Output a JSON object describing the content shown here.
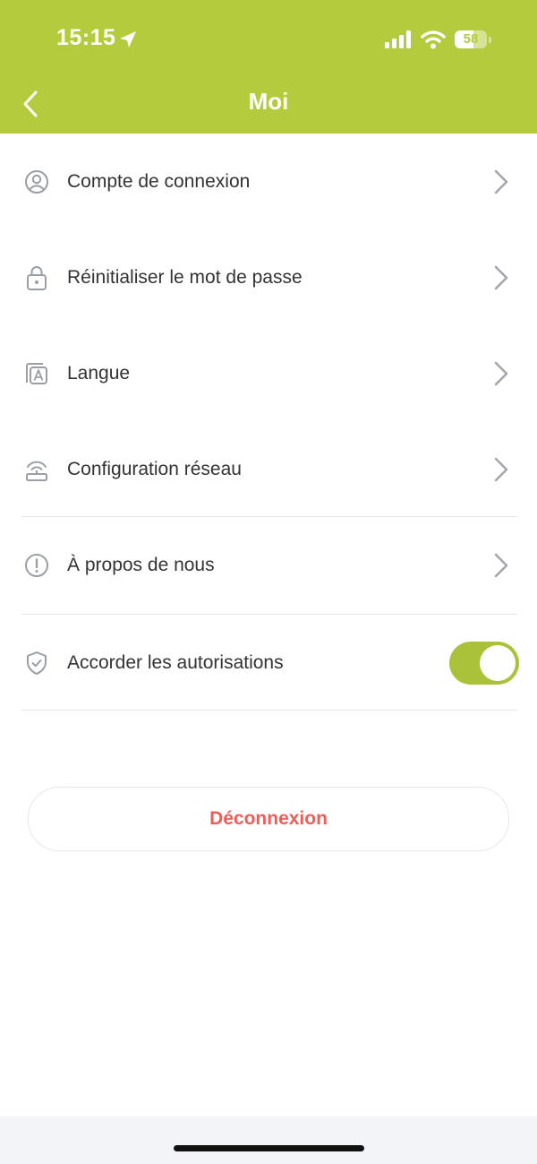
{
  "status_bar": {
    "time": "15:15",
    "battery_level": "58",
    "battery_percent": 58,
    "location_icon": "location-arrow-icon",
    "signal_icon": "cellular-signal-icon",
    "wifi_icon": "wifi-icon"
  },
  "header": {
    "title": "Moi",
    "back_icon": "chevron-left-icon",
    "background_color": "#b5cb3e"
  },
  "menu": {
    "items": [
      {
        "label": "Compte de connexion",
        "icon": "user-circle-icon",
        "trailing": "chevron-right-icon"
      },
      {
        "label": "Réinitialiser le mot de passe",
        "icon": "lock-icon",
        "trailing": "chevron-right-icon"
      },
      {
        "label": "Langue",
        "icon": "language-icon",
        "trailing": "chevron-right-icon"
      },
      {
        "label": "Configuration réseau",
        "icon": "router-icon",
        "trailing": "chevron-right-icon"
      },
      {
        "label": "À propos de nous",
        "icon": "info-circle-icon",
        "trailing": "chevron-right-icon"
      },
      {
        "label": "Accorder les autorisations",
        "icon": "shield-check-icon",
        "trailing": "toggle",
        "toggle_on": true
      }
    ]
  },
  "logout": {
    "label": "Déconnexion",
    "color": "#ef5d59"
  },
  "colors": {
    "accent": "#b5cb3e",
    "toggle_on": "#a9c23a",
    "text": "#333333",
    "icon": "#9a9fa6"
  }
}
